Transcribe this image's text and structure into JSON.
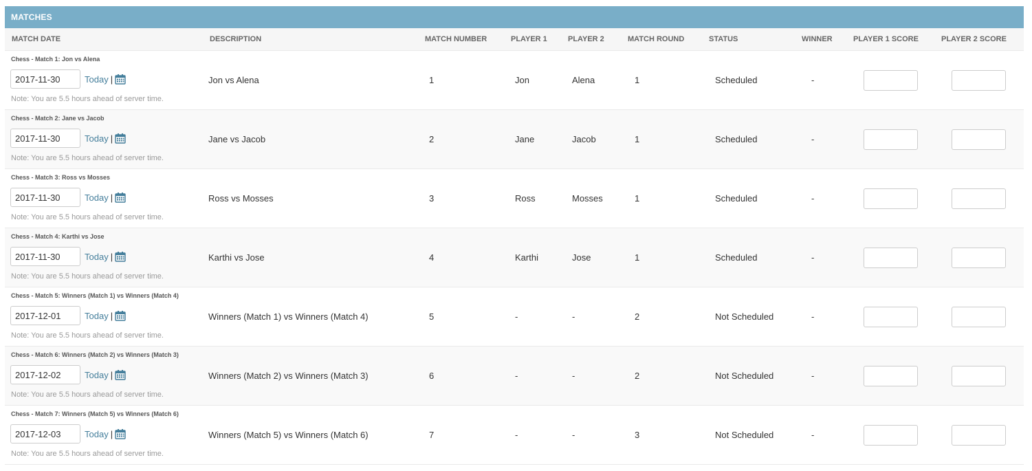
{
  "header": {
    "title": "MATCHES"
  },
  "columns": {
    "match_date": "MATCH DATE",
    "description": "DESCRIPTION",
    "match_number": "MATCH NUMBER",
    "player1": "PLAYER 1",
    "player2": "PLAYER 2",
    "match_round": "MATCH ROUND",
    "status": "STATUS",
    "winner": "WINNER",
    "player1_score": "PLAYER 1 SCORE",
    "player2_score": "PLAYER 2 SCORE"
  },
  "today_label": "Today",
  "separator": "|",
  "tz_note": "Note: You are 5.5 hours ahead of server time.",
  "rows": [
    {
      "title": "Chess - Match 1: Jon vs Alena",
      "date": "2017-11-30",
      "description": "Jon vs Alena",
      "number": "1",
      "player1": "Jon",
      "player2": "Alena",
      "round": "1",
      "status": "Scheduled",
      "winner": "-",
      "p1_score": "",
      "p2_score": ""
    },
    {
      "title": "Chess - Match 2: Jane vs Jacob",
      "date": "2017-11-30",
      "description": "Jane vs Jacob",
      "number": "2",
      "player1": "Jane",
      "player2": "Jacob",
      "round": "1",
      "status": "Scheduled",
      "winner": "-",
      "p1_score": "",
      "p2_score": ""
    },
    {
      "title": "Chess - Match 3: Ross vs Mosses",
      "date": "2017-11-30",
      "description": "Ross vs Mosses",
      "number": "3",
      "player1": "Ross",
      "player2": "Mosses",
      "round": "1",
      "status": "Scheduled",
      "winner": "-",
      "p1_score": "",
      "p2_score": ""
    },
    {
      "title": "Chess - Match 4: Karthi vs Jose",
      "date": "2017-11-30",
      "description": "Karthi vs Jose",
      "number": "4",
      "player1": "Karthi",
      "player2": "Jose",
      "round": "1",
      "status": "Scheduled",
      "winner": "-",
      "p1_score": "",
      "p2_score": ""
    },
    {
      "title": "Chess - Match 5: Winners (Match 1) vs Winners (Match 4)",
      "date": "2017-12-01",
      "description": "Winners (Match 1) vs Winners (Match 4)",
      "number": "5",
      "player1": "-",
      "player2": "-",
      "round": "2",
      "status": "Not Scheduled",
      "winner": "-",
      "p1_score": "",
      "p2_score": ""
    },
    {
      "title": "Chess - Match 6: Winners (Match 2) vs Winners (Match 3)",
      "date": "2017-12-02",
      "description": "Winners (Match 2) vs Winners (Match 3)",
      "number": "6",
      "player1": "-",
      "player2": "-",
      "round": "2",
      "status": "Not Scheduled",
      "winner": "-",
      "p1_score": "",
      "p2_score": ""
    },
    {
      "title": "Chess - Match 7: Winners (Match 5) vs Winners (Match 6)",
      "date": "2017-12-03",
      "description": "Winners (Match 5) vs Winners (Match 6)",
      "number": "7",
      "player1": "-",
      "player2": "-",
      "round": "3",
      "status": "Not Scheduled",
      "winner": "-",
      "p1_score": "",
      "p2_score": ""
    }
  ],
  "colors": {
    "header_bg": "#79aec8",
    "link": "#447e9b",
    "calendar_icon": "#447e9b"
  }
}
